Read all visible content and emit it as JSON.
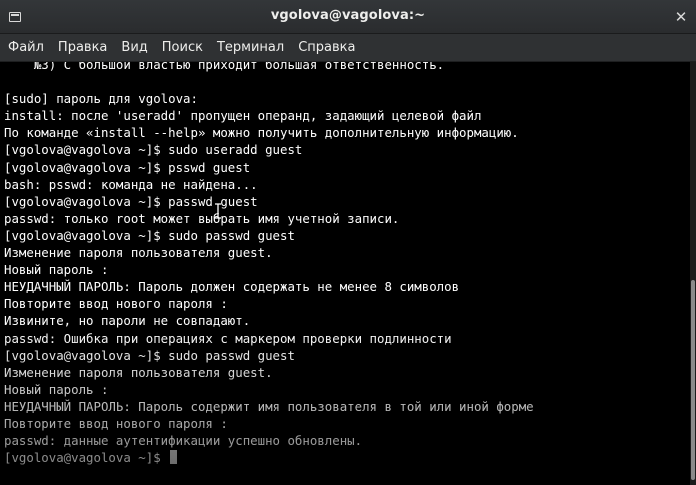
{
  "window": {
    "title": "vgolova@vagolova:~"
  },
  "menu": [
    {
      "label": "Файл"
    },
    {
      "label": "Правка"
    },
    {
      "label": "Вид"
    },
    {
      "label": "Поиск"
    },
    {
      "label": "Терминал"
    },
    {
      "label": "Справка"
    }
  ],
  "terminal": {
    "lines": [
      "    №3) С большой властью приходит большая ответственность.",
      "",
      "[sudo] пароль для vgolova:",
      "install: после 'useradd' пропущен операнд, задающий целевой файл",
      "По команде «install --help» можно получить дополнительную информацию.",
      "[vgolova@vagolova ~]$ sudo useradd guest",
      "[vgolova@vagolova ~]$ psswd guest",
      "bash: psswd: команда не найдена...",
      "[vgolova@vagolova ~]$ passwd guest",
      "passwd: только root может выбрать имя учетной записи.",
      "[vgolova@vagolova ~]$ sudo passwd guest",
      "Изменение пароля пользователя guest.",
      "Новый пароль :",
      "НЕУДАЧНЫЙ ПАРОЛЬ: Пароль должен содержать не менее 8 символов",
      "Повторите ввод нового пароля :",
      "Извините, но пароли не совпадают.",
      "passwd: Ошибка при операциях с маркером проверки подлинности",
      "[vgolova@vagolova ~]$ sudo passwd guest",
      "Изменение пароля пользователя guest.",
      "Новый пароль :",
      "НЕУДАЧНЫЙ ПАРОЛЬ: Пароль содержит имя пользователя в той или иной форме",
      "Повторите ввод нового пароля :",
      "passwd: данные аутентификации успешно обновлены.",
      "[vgolova@vagolova ~]$ "
    ]
  },
  "icons": {
    "new_tab": "new-tab-icon",
    "close": "close-icon"
  },
  "colors": {
    "terminal_bg": "#000000",
    "terminal_fg": "#ffffff",
    "titlebar_bg": "#2d2f31"
  }
}
